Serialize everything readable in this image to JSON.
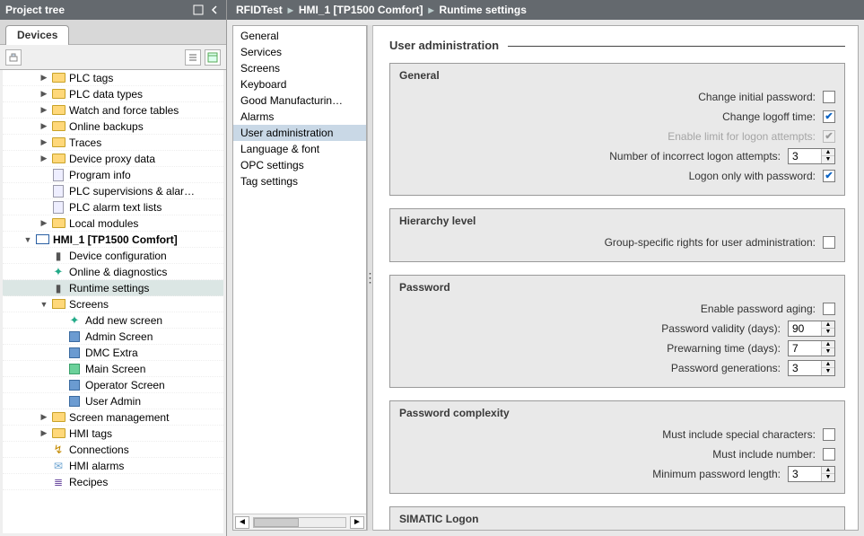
{
  "project_tree": {
    "title": "Project tree",
    "tab": "Devices",
    "items": [
      {
        "depth": 2,
        "twisty": "closed",
        "iconClass": "folder",
        "label": "PLC tags"
      },
      {
        "depth": 2,
        "twisty": "closed",
        "iconClass": "folder",
        "label": "PLC data types"
      },
      {
        "depth": 2,
        "twisty": "closed",
        "iconClass": "folder",
        "label": "Watch and force tables"
      },
      {
        "depth": 2,
        "twisty": "closed",
        "iconClass": "folder",
        "label": "Online backups"
      },
      {
        "depth": 2,
        "twisty": "closed",
        "iconClass": "folder",
        "label": "Traces"
      },
      {
        "depth": 2,
        "twisty": "closed",
        "iconClass": "folder",
        "label": "Device proxy data"
      },
      {
        "depth": 2,
        "twisty": "none",
        "iconClass": "doc",
        "label": "Program info"
      },
      {
        "depth": 2,
        "twisty": "none",
        "iconClass": "doc",
        "label": "PLC supervisions & alar…"
      },
      {
        "depth": 2,
        "twisty": "none",
        "iconClass": "doc",
        "label": "PLC alarm text lists"
      },
      {
        "depth": 2,
        "twisty": "closed",
        "iconClass": "folder",
        "label": "Local modules"
      },
      {
        "depth": 1,
        "twisty": "open",
        "iconClass": "hmi",
        "label": "HMI_1 [TP1500 Comfort]",
        "bold": true
      },
      {
        "depth": 2,
        "twisty": "none",
        "iconClass": "wrench",
        "label": "Device configuration"
      },
      {
        "depth": 2,
        "twisty": "none",
        "iconClass": "star",
        "label": "Online & diagnostics"
      },
      {
        "depth": 2,
        "twisty": "none",
        "iconClass": "wrench",
        "label": "Runtime settings",
        "selected": true
      },
      {
        "depth": 2,
        "twisty": "open",
        "iconClass": "folder-open",
        "label": "Screens"
      },
      {
        "depth": 3,
        "twisty": "none",
        "iconClass": "star",
        "label": "Add new screen"
      },
      {
        "depth": 3,
        "twisty": "none",
        "iconClass": "square-b",
        "label": "Admin Screen"
      },
      {
        "depth": 3,
        "twisty": "none",
        "iconClass": "square-b",
        "label": "DMC Extra"
      },
      {
        "depth": 3,
        "twisty": "none",
        "iconClass": "square-g",
        "label": "Main Screen"
      },
      {
        "depth": 3,
        "twisty": "none",
        "iconClass": "square-b",
        "label": "Operator Screen"
      },
      {
        "depth": 3,
        "twisty": "none",
        "iconClass": "square-b",
        "label": "User Admin"
      },
      {
        "depth": 2,
        "twisty": "closed",
        "iconClass": "folder",
        "label": "Screen management"
      },
      {
        "depth": 2,
        "twisty": "closed",
        "iconClass": "folder",
        "label": "HMI tags"
      },
      {
        "depth": 2,
        "twisty": "none",
        "iconClass": "conn",
        "label": "Connections"
      },
      {
        "depth": 2,
        "twisty": "none",
        "iconClass": "mail",
        "label": "HMI alarms"
      },
      {
        "depth": 2,
        "twisty": "none",
        "iconClass": "recipe",
        "label": "Recipes"
      }
    ]
  },
  "breadcrumb": [
    "RFIDTest",
    "HMI_1 [TP1500 Comfort]",
    "Runtime settings"
  ],
  "settings_nav": {
    "items": [
      "General",
      "Services",
      "Screens",
      "Keyboard",
      "Good Manufacturin…",
      "Alarms",
      "User administration",
      "Language & font",
      "OPC settings",
      "Tag settings"
    ],
    "selected_index": 6
  },
  "main": {
    "section_title": "User administration",
    "groups": {
      "general": {
        "title": "General",
        "change_initial_password": {
          "label": "Change initial password:",
          "checked": false
        },
        "change_logoff_time": {
          "label": "Change logoff time:",
          "checked": true
        },
        "enable_limit_attempts": {
          "label": "Enable limit for logon attempts:",
          "checked": true,
          "disabled": true
        },
        "num_incorrect_attempts": {
          "label": "Number of incorrect logon attempts:",
          "value": "3"
        },
        "logon_only_password": {
          "label": "Logon only with password:",
          "checked": true
        }
      },
      "hierarchy": {
        "title": "Hierarchy level",
        "group_rights": {
          "label": "Group-specific rights for user administration:",
          "checked": false
        }
      },
      "password": {
        "title": "Password",
        "enable_aging": {
          "label": "Enable password aging:",
          "checked": false
        },
        "validity_days": {
          "label": "Password validity (days):",
          "value": "90"
        },
        "prewarn_days": {
          "label": "Prewarning time (days):",
          "value": "7"
        },
        "generations": {
          "label": "Password generations:",
          "value": "3"
        }
      },
      "complexity": {
        "title": "Password complexity",
        "special": {
          "label": "Must include special characters:",
          "checked": false
        },
        "number": {
          "label": "Must include number:",
          "checked": false
        },
        "min_len": {
          "label": "Minimum password length:",
          "value": "3"
        }
      },
      "simatic": {
        "title": "SIMATIC Logon"
      }
    }
  }
}
